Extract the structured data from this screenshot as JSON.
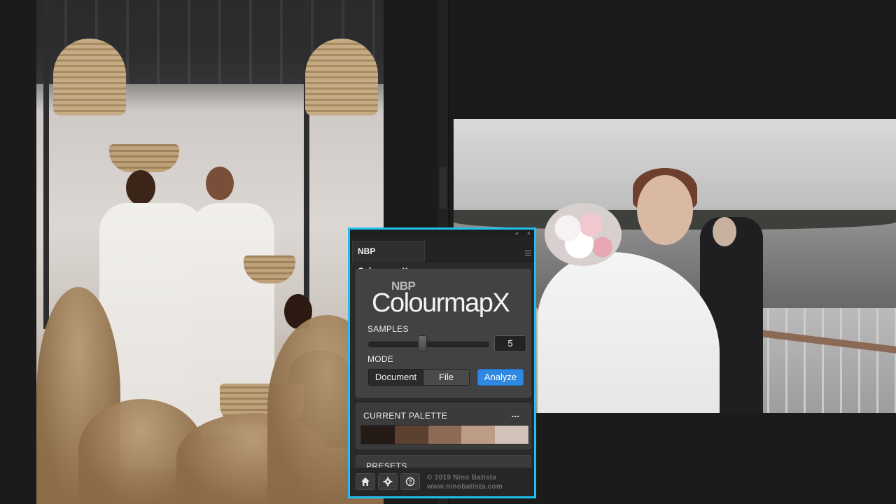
{
  "panel": {
    "tab_title": "NBP ColourmapX",
    "logo_top": "NBP",
    "logo_main": "ColourmapX",
    "samples_label": "SAMPLES",
    "samples_value": "5",
    "samples_slider_fraction": 0.45,
    "mode_label": "MODE",
    "mode_document": "Document",
    "mode_file": "File",
    "analyze_button": "Analyze",
    "palette_title": "CURRENT  PALETTE",
    "palette_more": "...",
    "palette_swatches": [
      "#241a16",
      "#5c4131",
      "#8d6a55",
      "#bc9c87",
      "#d2c2b9"
    ],
    "presets_title": "PRESETS",
    "footer": {
      "home_icon": "home-icon",
      "settings_icon": "gear-icon",
      "help_icon": "help-icon",
      "copyright_line1": "© 2019 Nino Batista",
      "copyright_line2": "www.ninobatista.com"
    },
    "top_controls": {
      "collapse": "«",
      "close": "×"
    }
  },
  "colors": {
    "panel_border": "#1fc0ef",
    "analyze_bg": "#2f88e1"
  }
}
